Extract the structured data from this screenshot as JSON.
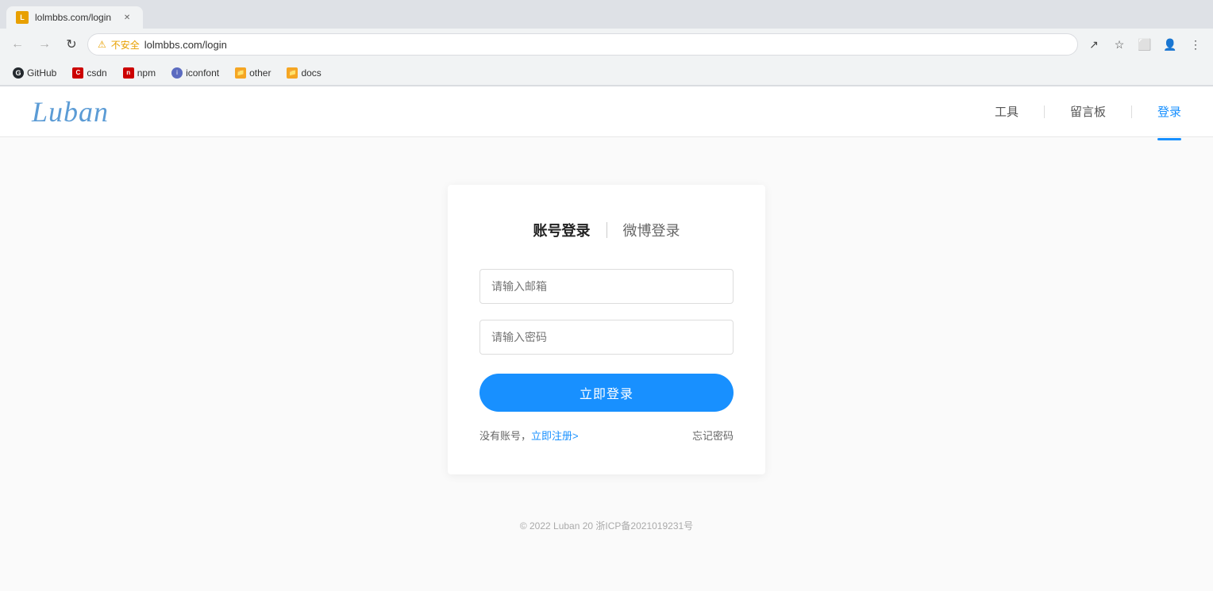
{
  "browser": {
    "tab": {
      "title": "lolmbbs.com/login",
      "favicon_label": "L"
    },
    "toolbar": {
      "back_label": "←",
      "forward_label": "→",
      "reload_label": "↻",
      "security_text": "不安全",
      "url": "lolmbbs.com/login",
      "share_icon": "↗",
      "star_icon": "☆",
      "extensions_icon": "⬜",
      "account_icon": "👤",
      "menu_icon": "⋮"
    },
    "bookmarks": [
      {
        "id": "github",
        "label": "GitHub",
        "color": "#24292e"
      },
      {
        "id": "csdn",
        "label": "csdn",
        "color": "#c00"
      },
      {
        "id": "npm",
        "label": "npm",
        "color": "#c00"
      },
      {
        "id": "iconfont",
        "label": "iconfont",
        "color": "#5b6bc0"
      },
      {
        "id": "other",
        "label": "other",
        "color": "#f5a623"
      },
      {
        "id": "docs",
        "label": "docs",
        "color": "#f5a623"
      }
    ]
  },
  "site": {
    "logo": "Luban",
    "nav": [
      {
        "id": "tools",
        "label": "工具",
        "active": false
      },
      {
        "id": "guestbook",
        "label": "留言板",
        "active": false
      },
      {
        "id": "login",
        "label": "登录",
        "active": true
      }
    ]
  },
  "login": {
    "tab_account": "账号登录",
    "tab_weibo": "微博登录",
    "email_placeholder": "请输入邮箱",
    "password_placeholder": "请输入密码",
    "submit_label": "立即登录",
    "register_prefix": "没有账号，",
    "register_link": "立即注册>",
    "forgot_label": "忘记密码"
  },
  "footer": {
    "text": "© 2022 Luban 20  浙ICP备2021019231号"
  }
}
